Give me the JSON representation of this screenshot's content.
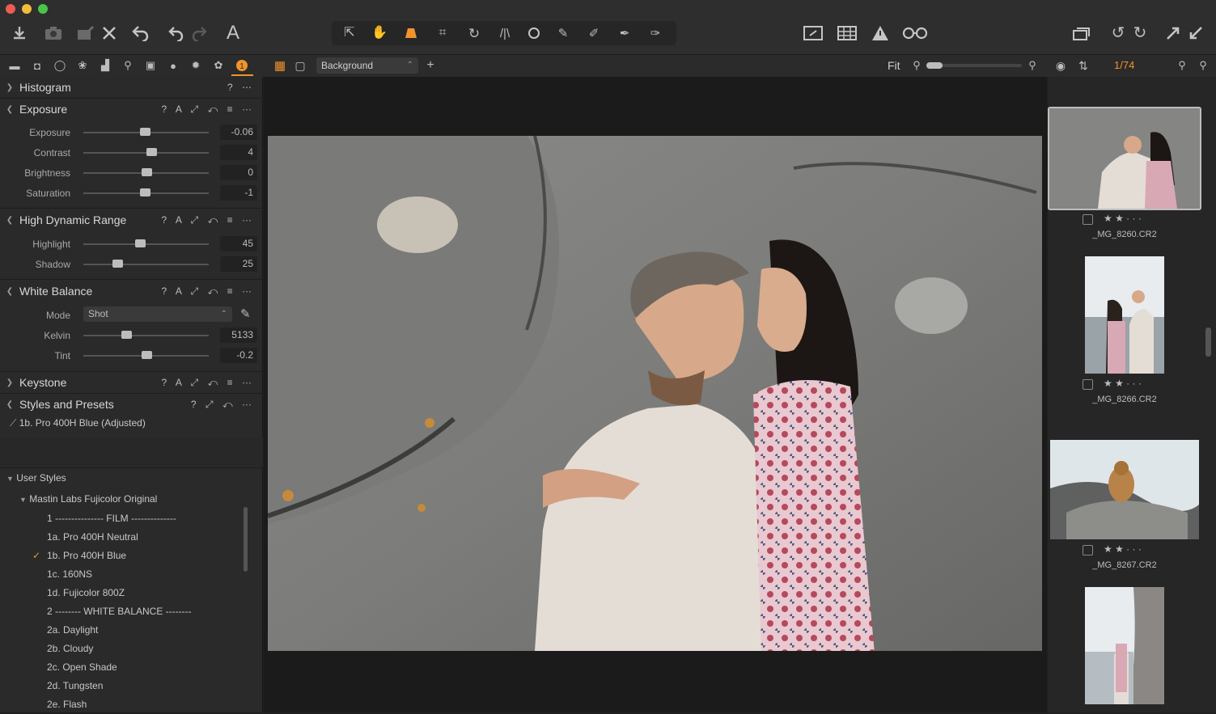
{
  "toolbar": {
    "icons": [
      "import-icon",
      "camera-icon",
      "edit-icon",
      "delete-icon",
      "undo-icon",
      "redo-icon",
      "redo-disabled-icon",
      "text-icon",
      "select-icon",
      "pan-icon",
      "tool-icon",
      "crop-icon",
      "rotate-icon",
      "keystone-icon",
      "spot-icon",
      "brush-icon",
      "eraser-icon",
      "gradient-icon",
      "picker-icon",
      "compare-icon",
      "grid-icon",
      "warning-icon",
      "glasses-icon",
      "browser-icon",
      "rotate-left-icon",
      "rotate-right-icon",
      "expand-icon",
      "export-icon"
    ]
  },
  "viewer": {
    "layer_select": "Background",
    "fit_label": "Fit",
    "counter": "1/74"
  },
  "left": {
    "histogram": "Histogram",
    "exposure": {
      "title": "Exposure",
      "sliders": [
        {
          "label": "Exposure",
          "value": "-0.06",
          "pos": 0.49
        },
        {
          "label": "Contrast",
          "value": "4",
          "pos": 0.54
        },
        {
          "label": "Brightness",
          "value": "0",
          "pos": 0.5
        },
        {
          "label": "Saturation",
          "value": "-1",
          "pos": 0.49
        }
      ]
    },
    "hdr": {
      "title": "High Dynamic Range",
      "sliders": [
        {
          "label": "Highlight",
          "value": "45",
          "pos": 0.45
        },
        {
          "label": "Shadow",
          "value": "25",
          "pos": 0.27
        }
      ]
    },
    "wb": {
      "title": "White Balance",
      "mode_label": "Mode",
      "mode_value": "Shot",
      "sliders": [
        {
          "label": "Kelvin",
          "value": "5133",
          "pos": 0.34
        },
        {
          "label": "Tint",
          "value": "-0.2",
          "pos": 0.5
        }
      ]
    },
    "keystone": "Keystone",
    "styles": {
      "title": "Styles and Presets",
      "applied": "1b. Pro 400H Blue (Adjusted)",
      "user_styles": "User Styles",
      "folder": "Mastin Labs Fujicolor Original",
      "items": [
        "1 --------------- FILM --------------",
        "1a. Pro 400H Neutral",
        "1b. Pro 400H Blue",
        "1c. 160NS",
        "1d. Fujicolor 800Z",
        "2 -------- WHITE BALANCE --------",
        "2a. Daylight",
        "2b. Cloudy",
        "2c. Open Shade",
        "2d. Tungsten",
        "2e. Flash"
      ],
      "checked_index": 2
    }
  },
  "browser": {
    "thumbs": [
      {
        "name": "_MG_8260.CR2",
        "stars": "★ ★ · · ·"
      },
      {
        "name": "_MG_8266.CR2",
        "stars": "★ ★ · · ·"
      },
      {
        "name": "_MG_8267.CR2",
        "stars": "★ ★ · · ·"
      }
    ]
  }
}
